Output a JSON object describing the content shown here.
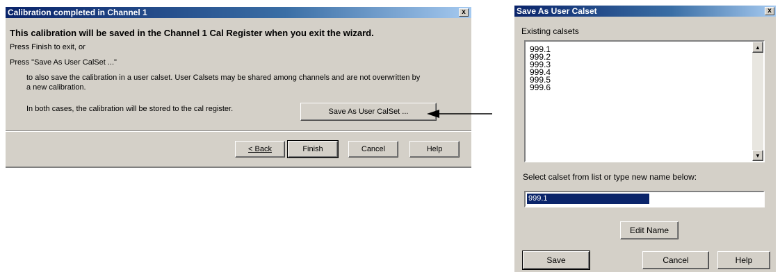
{
  "wizard": {
    "title": "Calibration completed in Channel 1",
    "heading": "This calibration will be saved in the Channel 1 Cal Register when you exit the wizard.",
    "line1": "Press Finish to exit, or",
    "line2": "Press \"Save As User CalSet ...\"",
    "line3": "to also save the calibration in a user calset.  User Calsets may be shared among channels and are not overwritten by",
    "line4": "a new calibration.",
    "line5": "In both cases, the calibration will be stored to the cal register.",
    "save_as_button": "Save As User CalSet ...",
    "back_button": "< Back",
    "finish_button": "Finish",
    "cancel_button": "Cancel",
    "help_button": "Help",
    "close_glyph": "x"
  },
  "dialog": {
    "title": "Save As User Calset",
    "existing_label": "Existing calsets",
    "calsets": [
      "999.1",
      "999.2",
      "999.3",
      "999.4",
      "999.5",
      "999.6"
    ],
    "select_label": "Select calset from list or type new name below:",
    "name_value": "999.1",
    "edit_name_button": "Edit Name",
    "save_button": "Save",
    "cancel_button": "Cancel",
    "help_button": "Help",
    "close_glyph": "x"
  },
  "colors": {
    "titlebar": "#0a246a",
    "face": "#d4d0c8",
    "selection": "#0a246a"
  }
}
